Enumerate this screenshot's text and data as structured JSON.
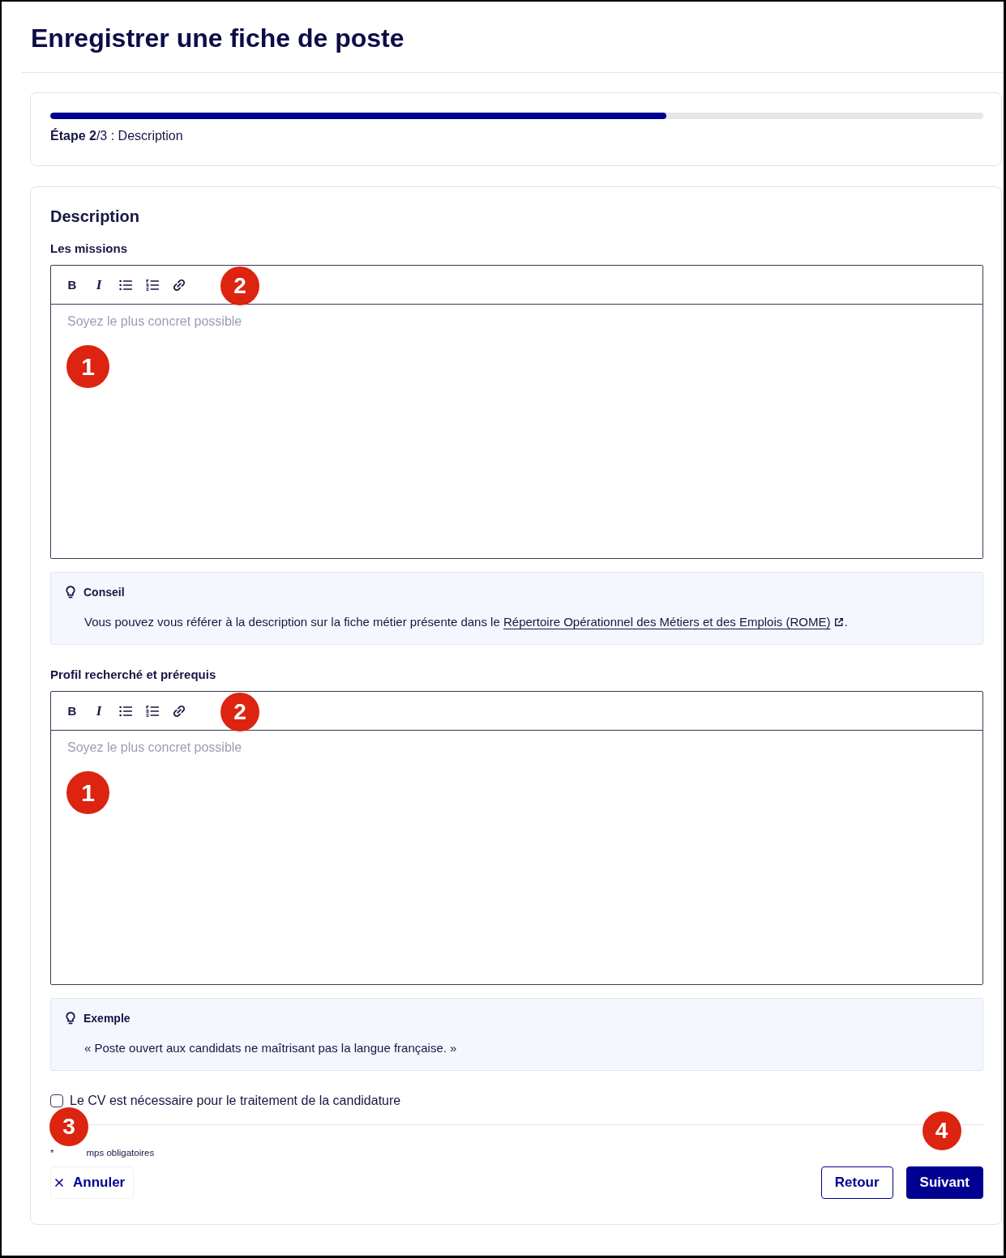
{
  "page": {
    "title": "Enregistrer une fiche de poste"
  },
  "stepper": {
    "level": 0.66,
    "text": "**Étape 2**/3 : Description"
  },
  "form": {
    "heading": "Description",
    "fields": [
      {
        "label": "Les missions",
        "toolbar": [
          {
            "kind": "bold",
            "label": "B"
          },
          {
            "kind": "italic",
            "label": "I"
          },
          {
            "kind": "bullet-list"
          },
          {
            "kind": "numbered-list"
          },
          {
            "kind": "link"
          }
        ],
        "toolbar_marker": "2",
        "placeholder": "Soyez le plus concret possible",
        "body_marker": "1",
        "tip": {
          "title": "Conseil",
          "text": "Vous pouvez vous référer à la description sur la fiche métier présente dans le",
          "link": "Répertoire Opérationnel des Métiers et des Emplois (ROME)",
          "text_after": "."
        }
      },
      {
        "label": "Profil recherché et prérequis",
        "toolbar": [
          {
            "kind": "bold",
            "label": "B"
          },
          {
            "kind": "italic",
            "label": "I"
          },
          {
            "kind": "bullet-list"
          },
          {
            "kind": "numbered-list"
          },
          {
            "kind": "link"
          }
        ],
        "toolbar_marker": "2",
        "placeholder": "Soyez le plus concret possible",
        "body_marker": "1",
        "tip": {
          "title": "Exemple",
          "text": "« Poste ouvert aux candidats ne maîtrisant pas la langue française. »"
        }
      }
    ],
    "checkbox": {
      "label": "Le CV est nécessaire pour le traitement de la candidature",
      "checked": false
    },
    "footnote": {
      "parts": [
        "*",
        "mps obligatoires"
      ],
      "marker": "3"
    },
    "actions": [
      {
        "kind": "tertiary",
        "label": "Annuler"
      },
      {
        "kind": "secondary",
        "label": "Retour"
      },
      {
        "kind": "primary",
        "label": "Suivant",
        "marker": "4"
      }
    ]
  }
}
